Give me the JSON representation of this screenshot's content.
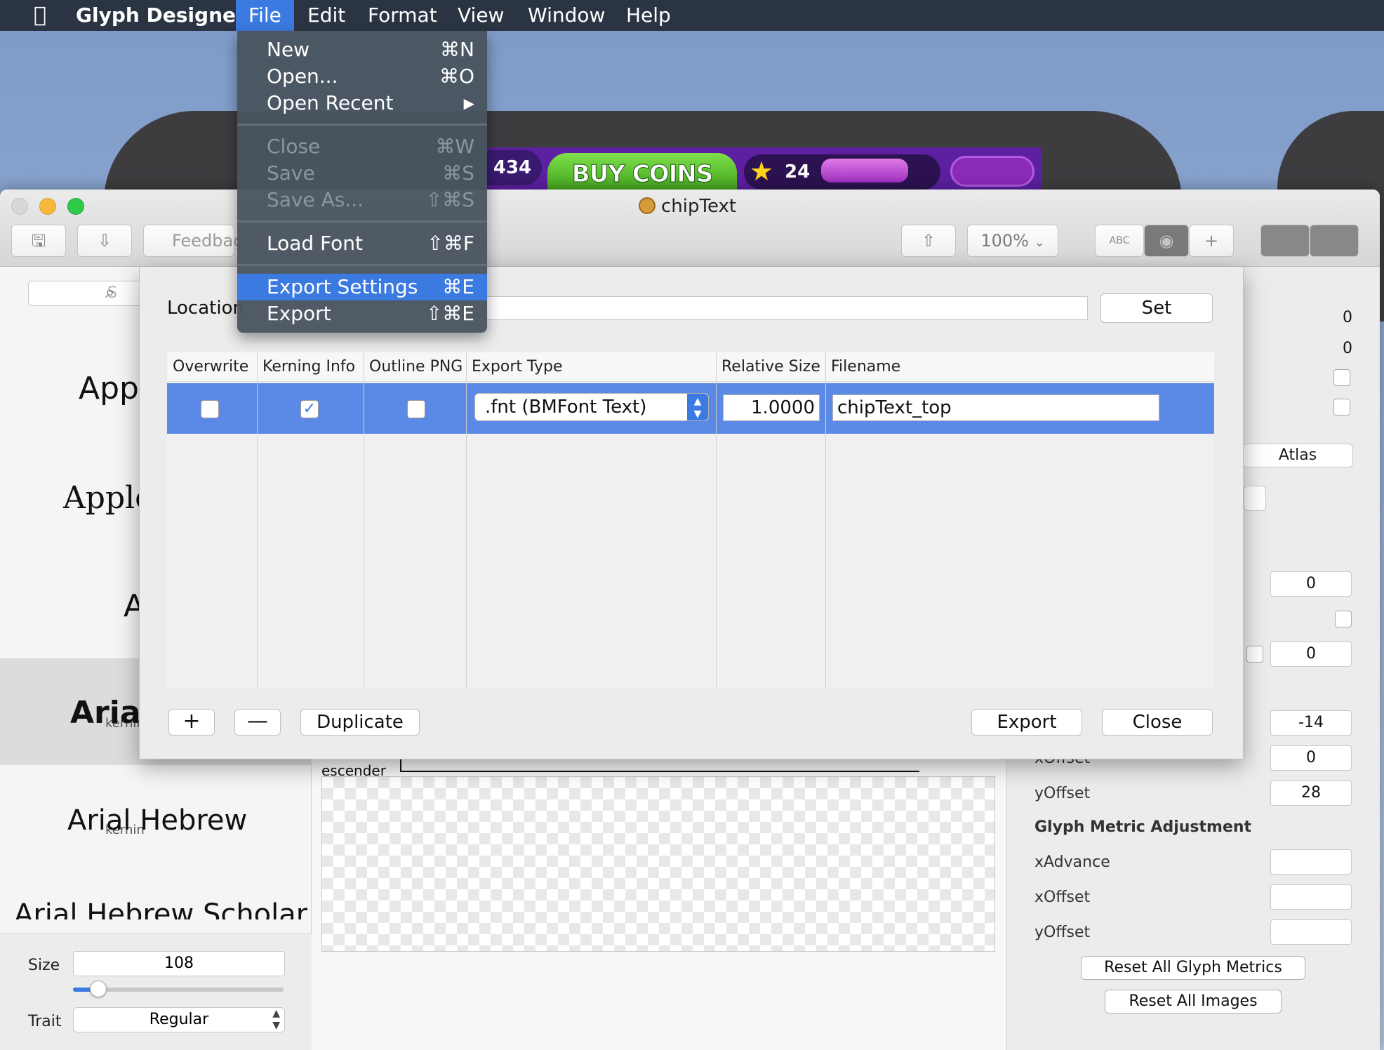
{
  "menubar": {
    "app_name": "Glyph Designer",
    "items": [
      "File",
      "Edit",
      "Format",
      "View",
      "Window",
      "Help"
    ]
  },
  "file_menu": {
    "items": [
      {
        "label": "New",
        "shortcut": "⌘N",
        "enabled": true
      },
      {
        "label": "Open...",
        "shortcut": "⌘O",
        "enabled": true
      },
      {
        "label": "Open Recent",
        "shortcut": "▶",
        "enabled": true
      },
      {
        "label": "Close",
        "shortcut": "⌘W",
        "enabled": false
      },
      {
        "label": "Save",
        "shortcut": "⌘S",
        "enabled": false
      },
      {
        "label": "Save As...",
        "shortcut": "⇧⌘S",
        "enabled": false
      },
      {
        "label": "Load Font",
        "shortcut": "⇧⌘F",
        "enabled": true
      },
      {
        "label": "Export Settings",
        "shortcut": "⌘E",
        "enabled": true,
        "highlighted": true
      },
      {
        "label": "Export",
        "shortcut": "⇧⌘E",
        "enabled": true
      }
    ]
  },
  "desktop": {
    "game": {
      "coin_count": "434",
      "buy_coins_label": "BUY COINS",
      "star_count": "24",
      "star_icon": "star-icon",
      "accent": "#5c20a0",
      "button_green": "#4fb52a"
    }
  },
  "window": {
    "title": "chipText",
    "toolbar": {
      "feedback_label": "Feedback",
      "zoom_value": "100%",
      "zoom_arrow": "⌄",
      "abc_label": "ABC",
      "eye_icon": "◉",
      "plus_icon": "+",
      "save_icon": "🖫",
      "import_icon": "⇩",
      "share_icon": "⇧"
    }
  },
  "left_panel": {
    "search_placeholder": "S",
    "fonts": [
      "Apple",
      "AppleI",
      "A",
      "Arial",
      "Arial Hebrew",
      "Arial Hebrew Scholar"
    ],
    "kerning_label": "kernin",
    "size_label": "Size",
    "size_value": "108",
    "size_slider_fraction": 0.08,
    "trait_label": "Trait",
    "trait_value": "Regular"
  },
  "canvas": {
    "escender_label": "escender"
  },
  "right_panel": {
    "top_values": [
      "0",
      "0"
    ],
    "atlas_label": "Atlas",
    "fields": [
      "0",
      "0",
      "-14",
      "0",
      "28"
    ],
    "x_offset_label": "xOffset",
    "y_offset_label": "yOffset",
    "glyph_metric_title": "Glyph Metric Adjustment",
    "gma_labels": [
      "xAdvance",
      "xOffset",
      "yOffset"
    ],
    "reset_metrics_label": "Reset All Glyph Metrics",
    "reset_images_label": "Reset All Images"
  },
  "export_sheet": {
    "location_label": "Location",
    "set_label": "Set",
    "columns": [
      "Overwrite",
      "Kerning Info",
      "Outline PNG",
      "Export Type",
      "Relative Size",
      "Filename"
    ],
    "row": {
      "overwrite": false,
      "kerning_info": true,
      "outline_png": false,
      "export_type": ".fnt (BMFont Text)",
      "relative_size": "1.0000",
      "filename": "chipText_top",
      "check_mark": "✓"
    },
    "add_label": "+",
    "remove_label": "—",
    "duplicate_label": "Duplicate",
    "export_label": "Export",
    "close_label": "Close"
  },
  "colors": {
    "accent": "#3b7ae0",
    "selection": "#5a8ae6",
    "menubar": "#2b3442"
  }
}
